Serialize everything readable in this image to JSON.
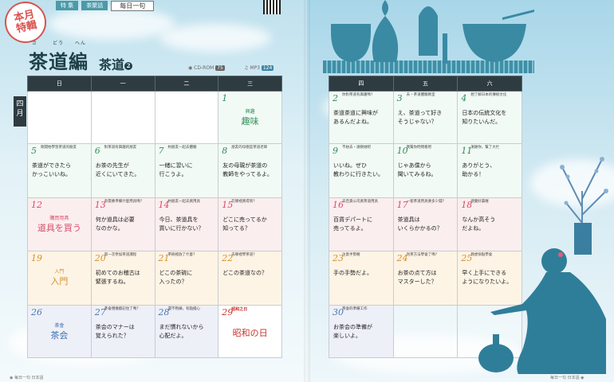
{
  "left_page": {
    "stamp": {
      "line1": "本月",
      "line2": "特輯"
    },
    "tabs": [
      "特 集",
      "茶聚話",
      "每日一句"
    ],
    "title": {
      "main": "茶道編",
      "ruby": [
        "さ",
        "どう",
        "へん"
      ],
      "sub": "茶道",
      "sub_mark": "2"
    },
    "tracks": [
      {
        "label": "CD-ROM",
        "num": "75"
      },
      {
        "label": "MP3",
        "num": "124"
      }
    ],
    "month_tab": "四月",
    "weekday_headers": [
      "日",
      "一",
      "二",
      "三"
    ],
    "footer": "每日一句 日本語"
  },
  "right_page": {
    "weekday_headers": [
      "四",
      "五",
      "六"
    ],
    "footer": "每日一句 日本語"
  },
  "calendar_left": [
    [
      {
        "style": "blank"
      },
      {
        "style": "blank"
      },
      {
        "style": "blank"
      },
      {
        "style": "mint",
        "day": "1",
        "color": "green",
        "event": {
          "small": "興趣",
          "big": "趣味"
        }
      }
    ],
    [
      {
        "style": "mint",
        "day": "5",
        "color": "green",
        "header": "剛開始學習茶道的朋友",
        "body": "茶道ができたら\nかっこいいね。"
      },
      {
        "style": "mint",
        "day": "6",
        "color": "green",
        "header": "對茶道有興趣的朋友",
        "body": "お茶の先生が\n近くにいてきた。"
      },
      {
        "style": "mint",
        "day": "7",
        "color": "green",
        "header": "約朋友一起去體驗",
        "body": "一緒に習いに\n行こうよ。"
      },
      {
        "style": "mint",
        "day": "8",
        "color": "green",
        "header": "朋友的母親是茶道老師",
        "body": "友の母親が茶道の\n教師をやってるよ。"
      }
    ],
    [
      {
        "style": "pink",
        "day": "12",
        "color": "pink",
        "event": {
          "small": "購買用具",
          "big": "道具を買う"
        }
      },
      {
        "style": "pink",
        "day": "13",
        "color": "pink",
        "header": "有需要準備什麼用具嗎？",
        "body": "何か道具は必要\nなのかな。"
      },
      {
        "style": "pink",
        "day": "14",
        "color": "pink",
        "header": "約朋友一起去買用具",
        "body": "今日、茶道具を\n買いに行かない？"
      },
      {
        "style": "pink",
        "day": "15",
        "color": "pink",
        "header": "在哪裡買得到？",
        "body": "どこに売ってるか\n知ってる？"
      }
    ],
    [
      {
        "style": "peach",
        "day": "19",
        "color": "orange",
        "event": {
          "small": "入門",
          "big": "入門"
        }
      },
      {
        "style": "peach",
        "day": "20",
        "color": "orange",
        "header": "第一次參加茶道課程",
        "body": "初めてのお稽古は\n緊張するね。"
      },
      {
        "style": "peach",
        "day": "21",
        "color": "orange",
        "header": "茶碗裡放了什麼？",
        "body": "どこの茶碗に\n入ったの？"
      },
      {
        "style": "peach",
        "day": "22",
        "color": "orange",
        "header": "去哪裡學茶道？",
        "body": "どこの茶道なの？"
      }
    ],
    [
      {
        "style": "lav",
        "day": "26",
        "color": "blue",
        "event": {
          "small": "茶會",
          "big": "茶会"
        }
      },
      {
        "style": "lav",
        "day": "27",
        "color": "blue",
        "header": "茶會禮儀都記住了嗎？",
        "body": "茶会のマナーは\n覚えられた？"
      },
      {
        "style": "lav",
        "day": "28",
        "color": "blue",
        "header": "還不熟練，有點擔心",
        "body": "まだ慣れないから\n心配だよ。"
      },
      {
        "style": "blank",
        "day": "29",
        "color": "red",
        "header": "昭和之日",
        "header_red": true,
        "event": {
          "small": "",
          "big": "昭和の日"
        }
      }
    ]
  ],
  "calendar_right": [
    [
      {
        "style": "mint",
        "day": "2",
        "color": "green",
        "header": "你對茶道有興趣嗎？",
        "body": "茶道茶道に興味が\nあるんだよね。"
      },
      {
        "style": "mint",
        "day": "3",
        "color": "green",
        "header": "去・茶道體驗教室",
        "body": "え、茶道って好き\nそうじゃない？"
      },
      {
        "style": "mint",
        "day": "4",
        "color": "green",
        "header": "想了解日本的傳統文化",
        "body": "日本の伝統文化を\n知りたいんだ。"
      }
    ],
    [
      {
        "style": "mint",
        "day": "9",
        "color": "green",
        "header": "不妨去・請教她吧",
        "body": "いいね。ぜひ\n教わりに行きたい。"
      },
      {
        "style": "mint",
        "day": "10",
        "color": "green",
        "header": "我幫你問問看吧",
        "body": "じゃあ僕から\n聞いてみるね。"
      },
      {
        "style": "mint",
        "day": "11",
        "color": "green",
        "header": "謝謝你，幫了大忙",
        "body": "ありがとう、\n助かる！"
      }
    ],
    [
      {
        "style": "pink",
        "day": "16",
        "color": "pink",
        "header": "去百貨公司買茶道用具",
        "body": "百貨デパートに\n売ってるよ。"
      },
      {
        "style": "pink",
        "day": "17",
        "color": "pink",
        "header": "一套茶道用具要多少錢？",
        "body": "茶道具は\nいくらかかるの？"
      },
      {
        "style": "pink",
        "day": "18",
        "color": "pink",
        "header": "感覺好貴喔",
        "body": "なんか高そう\nだよね。"
      }
    ],
    [
      {
        "style": "peach",
        "day": "23",
        "color": "orange",
        "header": "注意手勢喔",
        "body": "手の手勢だよ。"
      },
      {
        "style": "peach",
        "day": "24",
        "color": "orange",
        "header": "泡茶方法學會了嗎？",
        "body": "お茶の点て方は\nマスターした？"
      },
      {
        "style": "peach",
        "day": "25",
        "color": "orange",
        "header": "我想快點學會",
        "body": "早く上手にできる\nようになりたいよ。"
      }
    ],
    [
      {
        "style": "lav",
        "day": "30",
        "color": "blue",
        "header": "茶會的準備工作",
        "body": "お茶会の準備が\n楽しいよ。"
      },
      {
        "style": "empty"
      },
      {
        "style": "empty"
      }
    ]
  ]
}
